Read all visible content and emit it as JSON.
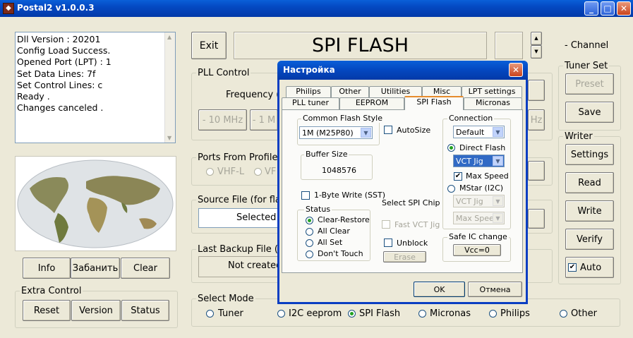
{
  "window": {
    "title": "Postal2 v1.0.0.3",
    "min": "_",
    "max": "□",
    "close": "✕"
  },
  "log": [
    "Dll Version : 20201",
    "Config Load Success.",
    "Opened Port (LPT) : 1",
    "Set Data Lines: 7f",
    "Set Control Lines: c",
    "Ready .",
    "Changes canceled ."
  ],
  "main": {
    "exit": "Exit",
    "mode_title": "SPI FLASH",
    "channel": "- Channel",
    "pll_control": "PLL Control",
    "frequency": "Frequency (",
    "minus10": "- 10 MHz",
    "minus1": "- 1 M",
    "mhz_cut": "Hz",
    "ports_from_profile": "Ports From Profile",
    "vhfl": "VHF-L",
    "vh": "VF",
    "source_file": "Source File (for flas",
    "selected": "Selected",
    "last_backup": "Last Backup File (N",
    "not_created": "Not created",
    "info": "Info",
    "ban": "Забанить",
    "clear": "Clear",
    "extra_control": "Extra Control",
    "reset": "Reset",
    "version": "Version",
    "status": "Status",
    "select_mode": "Select Mode",
    "modes": [
      "Tuner",
      "I2C eeprom",
      "SPI Flash",
      "Micronas",
      "Philips",
      "Other"
    ]
  },
  "tuner_set": {
    "title": "Tuner Set",
    "preset": "Preset",
    "save": "Save"
  },
  "writer": {
    "title": "Writer",
    "settings": "Settings",
    "read": "Read",
    "write": "Write",
    "verify": "Verify",
    "auto": "Auto"
  },
  "dialog": {
    "title": "Настройка",
    "close": "✕",
    "tabs_row1": [
      "Philips",
      "Other",
      "Utilities",
      "Misc",
      "LPT settings"
    ],
    "tabs_row2": [
      "PLL tuner",
      "EEPROM",
      "SPI Flash",
      "Micronas"
    ],
    "common_flash_style": "Common Flash Style",
    "flash_value": "1M (M25P80)",
    "autosize": "AutoSize",
    "buffer_size": "Buffer Size",
    "buffer_value": "1048576",
    "one_byte_write": "1-Byte Write (SST)",
    "select_spi_chip": "Select SPI Chip",
    "status": "Status",
    "status_opts": [
      "Clear-Restore",
      "All Clear",
      "All Set",
      "Don't Touch"
    ],
    "fast_vct_jig": "Fast VCT Jig",
    "unblock": "Unblock",
    "erase": "Erase",
    "connection": "Connection",
    "conn_value": "Default",
    "direct_flash": "Direct Flash",
    "vct_jig": "VCT Jig",
    "max_speed": "Max Speed",
    "mstar": "MStar (I2C)",
    "vct_jig2": "VCT Jig",
    "max_speed2": "Max Speed",
    "safe_ic_change": "Safe IC change",
    "vcc": "Vcc=0",
    "ok": "OK",
    "cancel": "Отмена"
  }
}
